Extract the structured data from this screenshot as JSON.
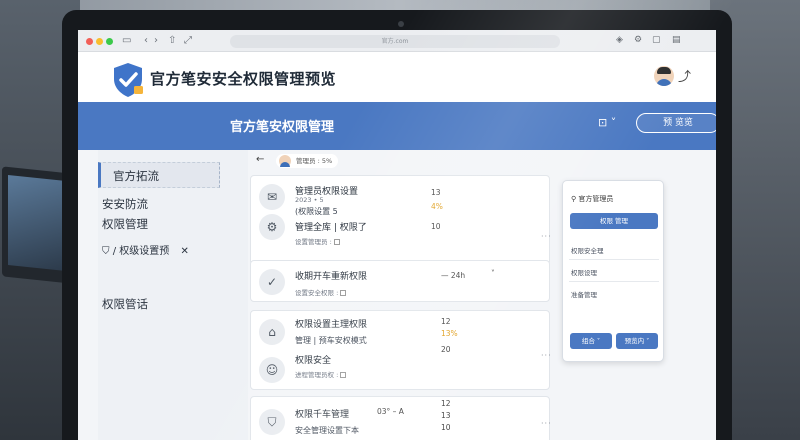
{
  "browser": {
    "url": "官方.com",
    "nav_icons": [
      "sidebar-icon",
      "back-icon",
      "forward-icon",
      "share-icon",
      "expand-icon"
    ],
    "right_icons": [
      "extensions-icon",
      "settings-icon",
      "copy-icon",
      "tabs-icon"
    ]
  },
  "header": {
    "app_title": "官方笔安安全权限管理预览",
    "icons": [
      "shield-logo",
      "user-avatar",
      "switch-icon"
    ]
  },
  "section": {
    "title": "官方笔安权限管理",
    "action_label": "预  览览"
  },
  "sidebar": {
    "items": [
      {
        "label": "官方拓流"
      },
      {
        "label": "安安防流"
      },
      {
        "label": "权限管理"
      },
      {
        "label": "/ 权级设置预"
      },
      {
        "label": "权限管话"
      }
    ]
  },
  "toolbar": {
    "chip_text": "管理员 : 5%"
  },
  "groups": [
    {
      "rows": [
        {
          "lines": [
            "管理员权限设置",
            "2023 • 5",
            "(权限设置 5"
          ],
          "values": [
            "13",
            "4%",
            ""
          ]
        },
        {
          "lines": [
            "管理全库 | 权限了",
            "设置管理员 :"
          ],
          "values": [
            "10"
          ]
        }
      ]
    },
    {
      "rows": [
        {
          "lines": [
            "收期开车重新权限",
            "设置安全权限 :"
          ],
          "values": [
            "— 24h"
          ]
        }
      ]
    },
    {
      "rows": [
        {
          "lines": [
            "权限设置主理权限",
            "管理 | 预车安权模式"
          ],
          "values": [
            "12",
            "13%"
          ]
        },
        {
          "lines": [
            "权限安全",
            "进程管理员权 :"
          ],
          "values": [
            "20"
          ]
        }
      ]
    },
    {
      "rows": [
        {
          "lines": [
            "权限千车管理",
            "安全管理设置下本"
          ],
          "values": [
            "03° – A",
            "12",
            "13",
            "10"
          ]
        }
      ]
    }
  ],
  "right_panel": {
    "title": "官方管理员",
    "primary_label": "权限 管理",
    "items": [
      "权限安全理",
      "权限设理",
      "准备管理"
    ],
    "btn_left": "组合",
    "btn_right": "预览内"
  },
  "colors": {
    "accent": "#4a78c2",
    "warn": "#e0a020"
  }
}
